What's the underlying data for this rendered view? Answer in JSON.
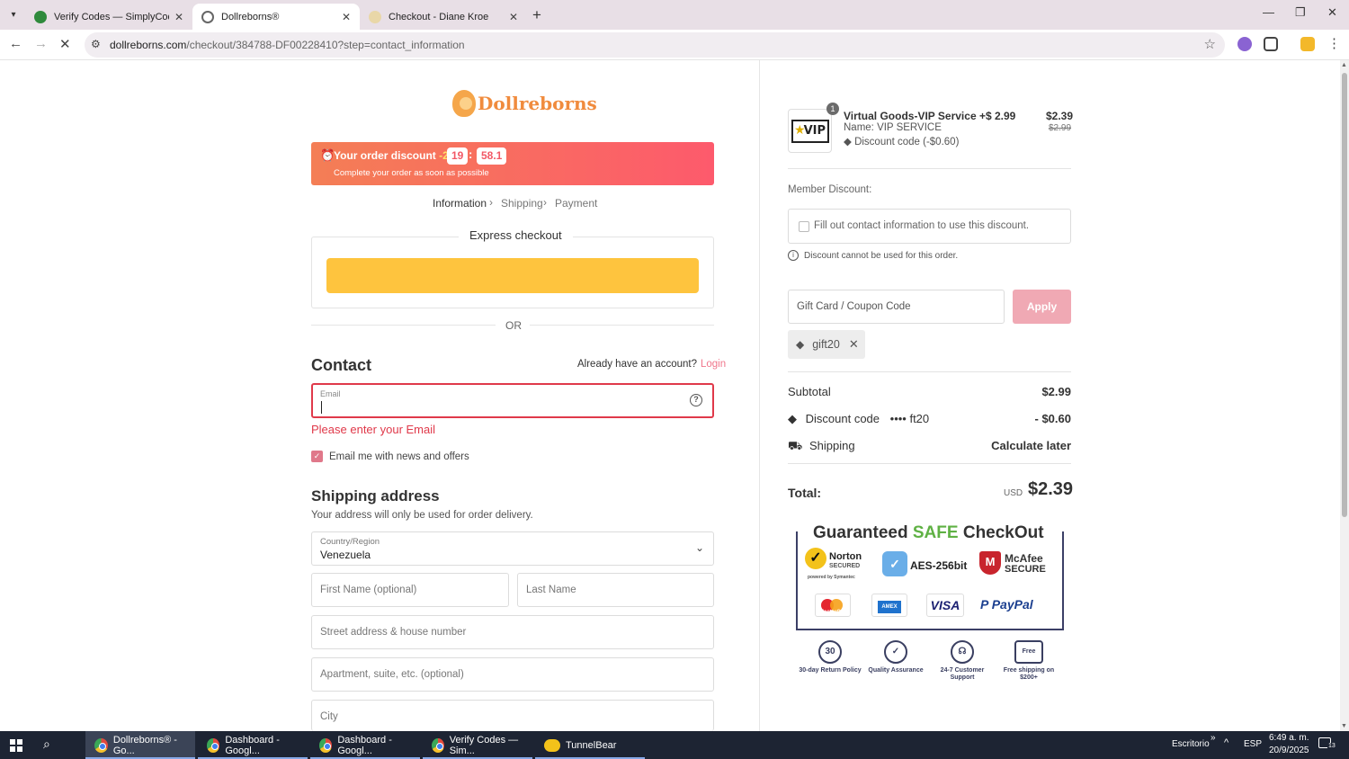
{
  "browser": {
    "tabs": [
      {
        "title": "Verify Codes — SimplyCodes",
        "icon": "simplycodes-favicon",
        "active": false
      },
      {
        "title": "Dollreborns®",
        "icon": "dollreborns-favicon",
        "active": true
      },
      {
        "title": "Checkout - Diane Kroe",
        "icon": "dianekroe-favicon",
        "active": false
      }
    ],
    "url_host": "dollreborns.com",
    "url_path": "/checkout/384788-DF00228410?step=contact_information",
    "new_tab_glyph": "+",
    "window_controls": [
      "—",
      "❐",
      "✕"
    ]
  },
  "store": {
    "logo_text": "Dollreborns"
  },
  "banner": {
    "text_prefix": "Your order discount",
    "discount": "-20%",
    "minutes": "19",
    "colon": ":",
    "seconds": "58.1",
    "subtext": "Complete your order as soon as possible"
  },
  "breadcrumbs": [
    "Information",
    "Shipping",
    "Payment"
  ],
  "express": {
    "title": "Express checkout",
    "or": "OR"
  },
  "contact": {
    "heading": "Contact",
    "account_prompt": "Already have an account?",
    "login": "Login",
    "email_label": "Email",
    "email_value": "",
    "error": "Please enter your Email",
    "newsletter": "Email me with news and offers",
    "newsletter_checked": true
  },
  "shipping": {
    "heading": "Shipping address",
    "note": "Your address will only be used for order delivery.",
    "country_label": "Country/Region",
    "country_value": "Venezuela",
    "first_name_ph": "First Name (optional)",
    "last_name_ph": "Last Name",
    "street_ph": "Street address & house number",
    "apartment_ph": "Apartment, suite, etc. (optional)",
    "city_ph": "City"
  },
  "summary": {
    "item": {
      "qty": "1",
      "name": "Virtual Goods-VIP Service +$ 2.99",
      "variant": "Name: VIP SERVICE",
      "discount": "Discount code (-$0.60)",
      "price": "$2.39",
      "old_price": "$2.99",
      "thumb_text": "VIP"
    },
    "member_label": "Member Discount:",
    "member_checkbox": "Fill out contact information to use this discount.",
    "member_note": "Discount cannot be used for this order.",
    "coupon_ph": "Gift Card / Coupon Code",
    "apply": "Apply",
    "applied_code": "gift20",
    "subtotal_label": "Subtotal",
    "subtotal_value": "$2.99",
    "discount_label": "Discount code",
    "discount_code": "•••• ft20",
    "discount_value": "- $0.60",
    "shipping_label": "Shipping",
    "shipping_value": "Calculate later",
    "total_label": "Total:",
    "currency": "USD",
    "total_value": "$2.39"
  },
  "trust": {
    "title_1": "Guaranteed ",
    "title_2": "SAFE",
    "title_3": " CheckOut",
    "norton": "Norton",
    "norton_sub": "SECURED",
    "norton_powered": "powered by Symantec",
    "aes": "AES-256bit",
    "mcafee": "McAfee",
    "mcafee_sub": "SECURE",
    "cards": [
      "MasterCard",
      "AMEX",
      "VISA",
      "PayPal"
    ],
    "badges": [
      {
        "icon": "30",
        "label": "30-day Return Policy"
      },
      {
        "icon": "✓",
        "label": "Quality Assurance"
      },
      {
        "icon": "☊",
        "label": "24-7 Customer Support"
      },
      {
        "icon": "Free",
        "label": "Free shipping on $200+"
      }
    ]
  },
  "taskbar": {
    "apps": [
      {
        "label": "Dollreborns® - Go...",
        "active": true
      },
      {
        "label": "Dashboard - Googl...",
        "active": false
      },
      {
        "label": "Dashboard - Googl...",
        "active": false
      },
      {
        "label": "Verify Codes — Sim...",
        "active": false
      },
      {
        "label": "TunnelBear",
        "active": false
      }
    ],
    "desktop": "Escritorio",
    "lang": "ESP",
    "time": "6:49 a. m.",
    "date": "20/9/2025",
    "notif_count": "13"
  }
}
